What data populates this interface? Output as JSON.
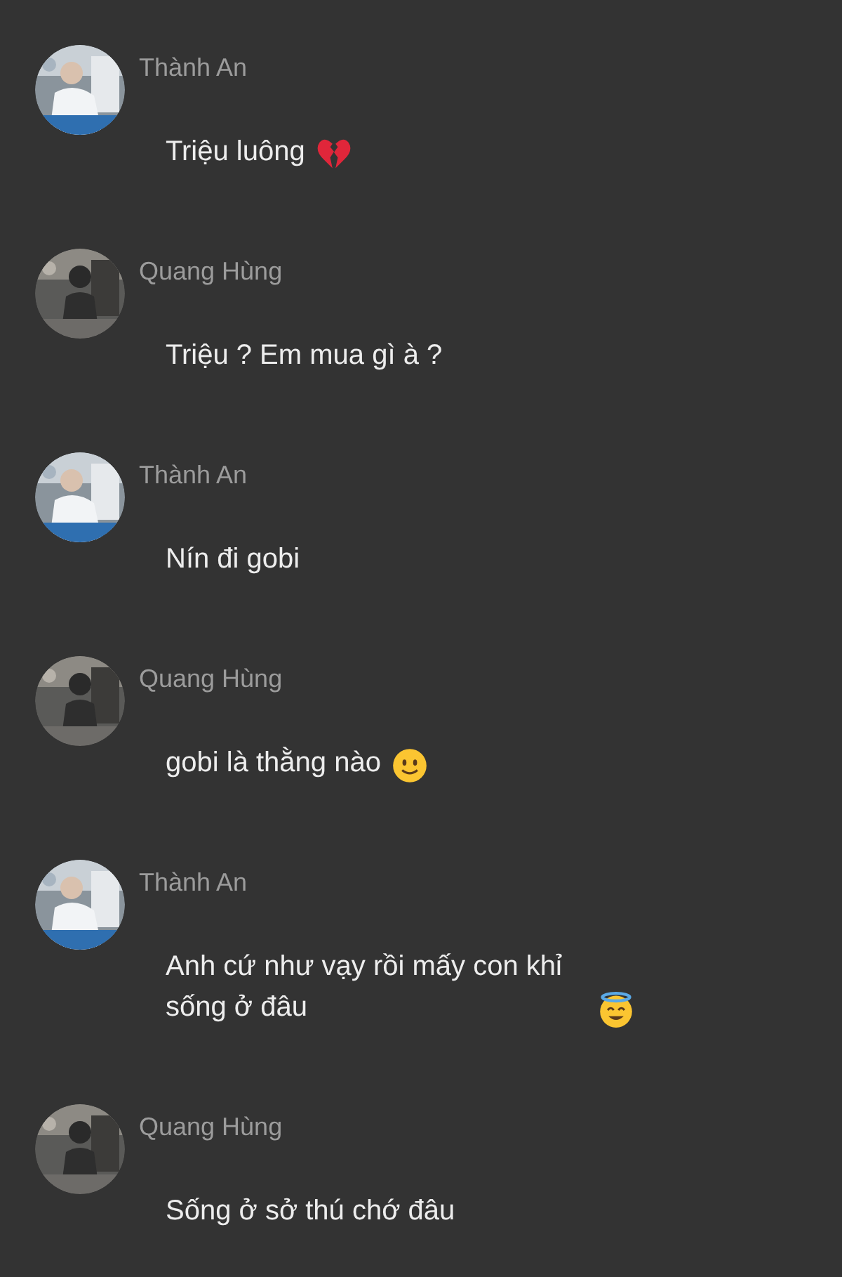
{
  "messages": [
    {
      "sender": "Thành An",
      "text": "Triệu luông",
      "kind": "broken-heart"
    },
    {
      "sender": "Quang Hùng",
      "text": "Triệu ? Em mua gì à ?",
      "kind": "plain"
    },
    {
      "sender": "Thành An",
      "text": "Nín đi gobi",
      "kind": "plain"
    },
    {
      "sender": "Quang Hùng",
      "text": "gobi là thằng nào",
      "kind": "smile"
    },
    {
      "sender": "Thành An",
      "text": "Anh cứ như vạy rồi mấy con khỉ sống ở đâu",
      "kind": "halo"
    },
    {
      "sender": "Quang Hùng",
      "text": "Sống ở sở thú chớ đâu",
      "kind": "plain"
    }
  ]
}
